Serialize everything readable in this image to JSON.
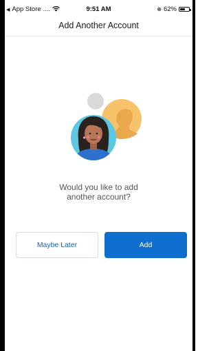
{
  "status_bar": {
    "back_label": "App Store",
    "signal": "....",
    "time": "9:51 AM",
    "battery": "62%",
    "battery_level": 0.62
  },
  "nav": {
    "title": "Add Another Account"
  },
  "prompt": {
    "line1": "Would you like to add",
    "line2": "another account?"
  },
  "buttons": {
    "later": "Maybe Later",
    "add": "Add"
  },
  "colors": {
    "primary": "#0f6fcf",
    "avatar_circle": "#5bc7e3",
    "orange_circle": "#f6c36b",
    "gray_circle": "#d9d9d9"
  }
}
